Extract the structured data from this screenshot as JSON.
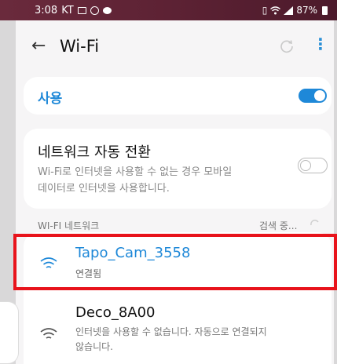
{
  "status_bar": {
    "time": "3:08",
    "carrier": "KT",
    "battery_percent": "87%",
    "icons": [
      "gallery-icon",
      "alarm-icon",
      "message-icon",
      "vibrate-icon",
      "wifi-icon",
      "signal-icon",
      "battery-icon"
    ]
  },
  "appbar": {
    "title": "Wi-Fi",
    "back_icon": "arrow-left-icon",
    "refresh_icon": "refresh-icon",
    "more_icon": "more-vert-icon"
  },
  "master_toggle": {
    "label": "사용",
    "on": true
  },
  "auto_switch": {
    "title": "네트워크 자동 전환",
    "description_line1": "Wi-Fi로 인터넷을 사용할 수 없는 경우 모바일",
    "description_line2": "데이터로 인터넷을 사용합니다.",
    "on": false
  },
  "networks_section": {
    "header": "WI-FI 네트워크",
    "scan_status": "검색 중..."
  },
  "networks": [
    {
      "ssid": "Tapo_Cam_3558",
      "status": "연결됨",
      "connected": true
    },
    {
      "ssid": "Deco_8A00",
      "status_line1": "인터넷을 사용할 수 없습니다. 자동으로 연결되지",
      "status_line2": "않습니다.",
      "connected": false
    }
  ],
  "colors": {
    "accent": "#1e88d8",
    "status_bar": "#5d2234",
    "highlight": "#e8131b"
  }
}
